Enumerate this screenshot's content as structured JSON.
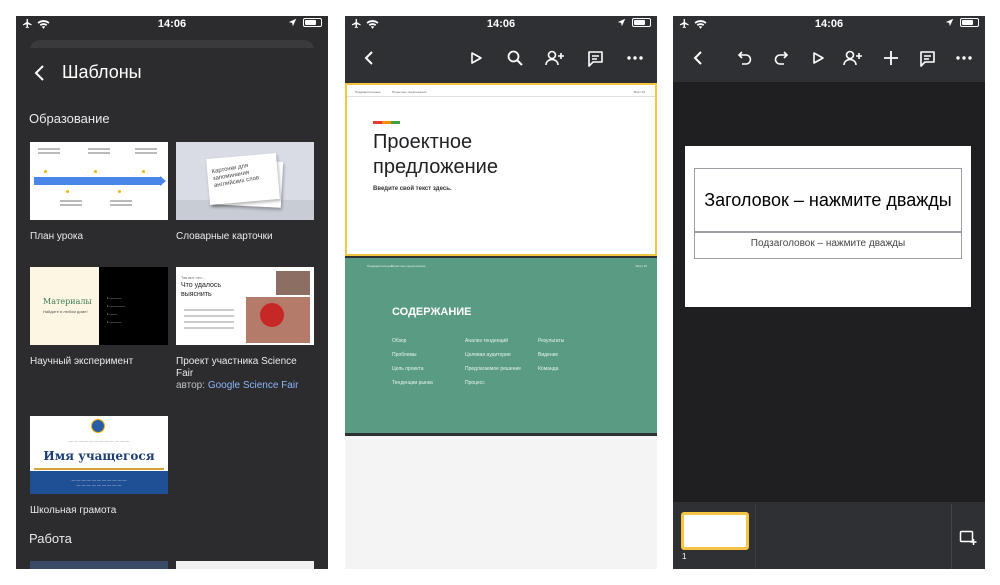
{
  "status_bar": {
    "time": "14:06"
  },
  "panel1": {
    "title": "Шаблоны",
    "sections": [
      {
        "title": "Образование",
        "templates": [
          {
            "label": "План урока",
            "author": ""
          },
          {
            "label": "Словарные карточки",
            "author": "",
            "thumb_text": "Карточки для запоминания английских слов"
          },
          {
            "label": "Научный эксперимент",
            "author": "",
            "thumb_title": "Материалы",
            "thumb_sub": "Найдите в любом доме!"
          },
          {
            "label": "Проект участника Science Fair",
            "author_prefix": "автор:",
            "author": "Google Science Fair",
            "thumb_q": "Так вот что...",
            "thumb_title": "Что удалось выяснить"
          },
          {
            "label": "Школьная грамота",
            "author": "",
            "thumb_name": "Имя учащегося"
          }
        ]
      },
      {
        "title": "Работа",
        "templates": []
      }
    ]
  },
  "panel2": {
    "slides": [
      {
        "title": "Проектное предложение",
        "subtitle": "Введите свой текст здесь.",
        "header_left": "Предварительные",
        "header_mid": "Проектное предложение",
        "header_right": "Март 20"
      },
      {
        "title": "СОДЕРЖАНИЕ",
        "columns": [
          [
            "Обзор",
            "Проблемы",
            "Цель проекта",
            "Тенденции рынка"
          ],
          [
            "Анализ тенденций",
            "Целевая аудитория",
            "Предлагаемое решение",
            "Процесс"
          ],
          [
            "Результаты",
            "Видение",
            "Команда"
          ]
        ]
      }
    ]
  },
  "panel3": {
    "slide_title": "Заголовок – нажмите дважды",
    "slide_subtitle": "Подзаголовок – нажмите дважды",
    "thumbnail_number": "1"
  },
  "colors": {
    "dark_bg": "#2c2c2e",
    "editor_bg": "#2f3033",
    "selection": "#f4c542",
    "link": "#8ab4f8",
    "teal_slide": "#5a9b84"
  }
}
